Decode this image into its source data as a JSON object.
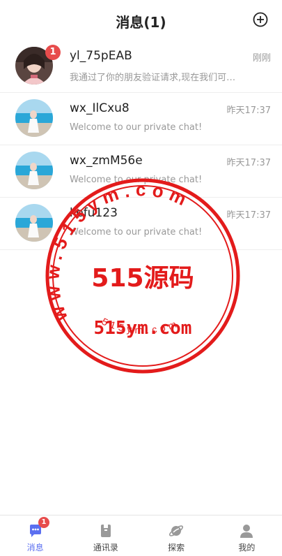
{
  "header": {
    "title": "消息(1)"
  },
  "chats": [
    {
      "name": "yl_75pEAB",
      "time": "刚刚",
      "preview": "我通过了你的朋友验证请求,现在我们可以...",
      "badge": "1",
      "avatar": "girl"
    },
    {
      "name": "wx_IlCxu8",
      "time": "昨天17:37",
      "preview": "Welcome to our private chat!",
      "avatar": "beach"
    },
    {
      "name": "wx_zmM56e",
      "time": "昨天17:37",
      "preview": "Welcome to our private chat!",
      "avatar": "beach"
    },
    {
      "name": "kefu123",
      "time": "昨天17:37",
      "preview": "Welcome to our private chat!",
      "avatar": "beach"
    }
  ],
  "watermark": {
    "ring_text": "www.515ym.com",
    "main": "515源码",
    "site": "515ym.com",
    "bottom": "515ym.com",
    "color": "#e31b1b"
  },
  "tabbar": {
    "items": [
      {
        "label": "消息",
        "badge": "1",
        "active": true
      },
      {
        "label": "通讯录"
      },
      {
        "label": "探索"
      },
      {
        "label": "我的"
      }
    ]
  },
  "colors": {
    "accent": "#5b6ff0",
    "badge": "#e74c4c"
  }
}
